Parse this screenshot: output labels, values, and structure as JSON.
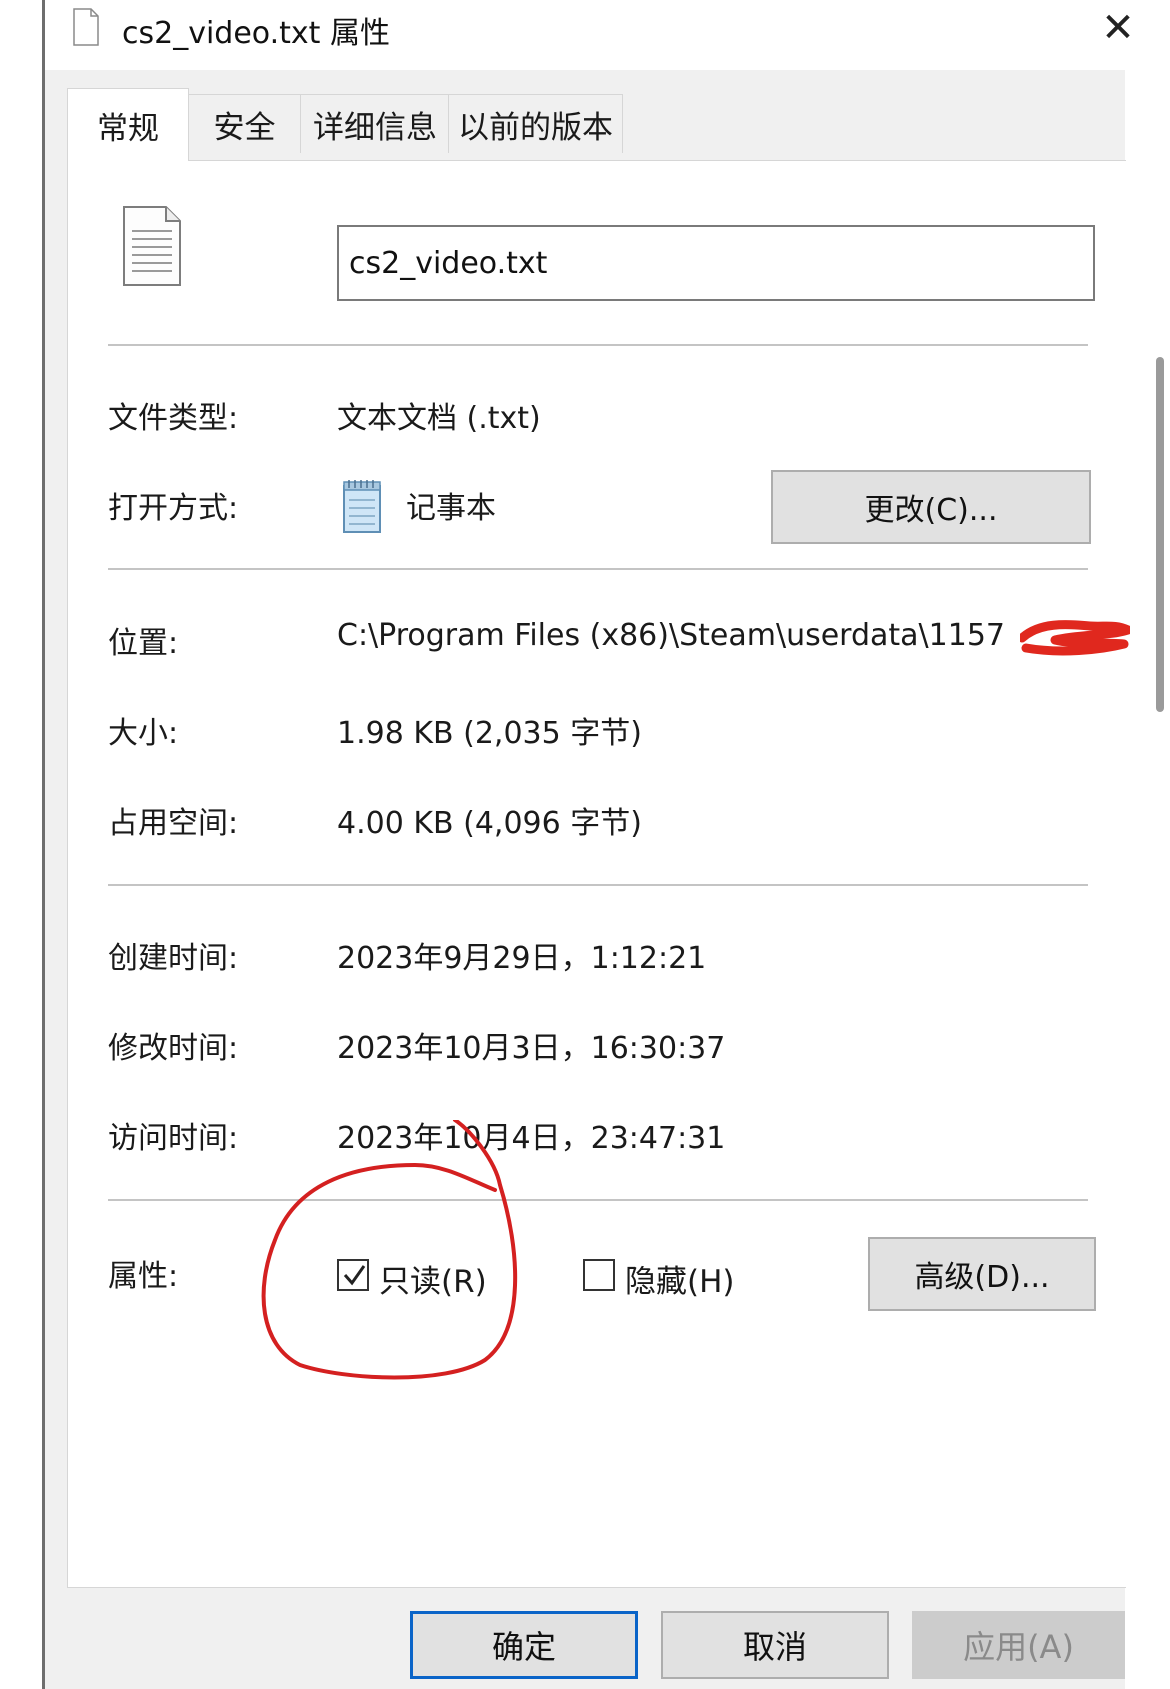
{
  "window": {
    "title": "cs2_video.txt 属性",
    "close_icon": "close-icon"
  },
  "tabs": [
    {
      "label": "常规",
      "active": true
    },
    {
      "label": "安全"
    },
    {
      "label": "详细信息"
    },
    {
      "label": "以前的版本"
    }
  ],
  "general": {
    "filename": "cs2_video.txt",
    "file_type_label": "文件类型:",
    "file_type_value": "文本文档 (.txt)",
    "open_with_label": "打开方式:",
    "open_with_value": "记事本",
    "change_button": "更改(C)...",
    "location_label": "位置:",
    "location_value": "C:\\Program Files (x86)\\Steam\\userdata\\1157",
    "size_label": "大小:",
    "size_value": "1.98 KB (2,035 字节)",
    "disk_size_label": "占用空间:",
    "disk_size_value": "4.00 KB (4,096 字节)",
    "created_label": "创建时间:",
    "created_value": "2023年9月29日，1:12:21",
    "modified_label": "修改时间:",
    "modified_value": "2023年10月3日，16:30:37",
    "accessed_label": "访问时间:",
    "accessed_value": "2023年10月4日，23:47:31",
    "attributes_label": "属性:",
    "readonly_label": "只读(R)",
    "readonly_checked": true,
    "hidden_label": "隐藏(H)",
    "hidden_checked": false,
    "advanced_button": "高级(D)..."
  },
  "footer": {
    "ok": "确定",
    "cancel": "取消",
    "apply": "应用(A)"
  },
  "colors": {
    "annotation": "#d42020",
    "redaction": "#e0281e",
    "primary_border": "#0a64c8"
  }
}
